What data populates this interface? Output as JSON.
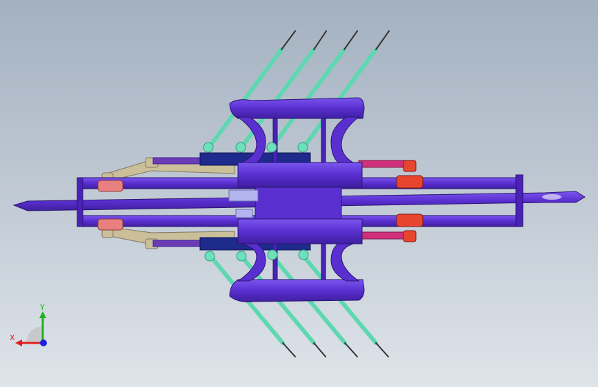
{
  "view": {
    "background_top": "#a3b1c0",
    "background_bottom": "#dfe4ea"
  },
  "model": {
    "colors": {
      "frame": "#5a2fd0",
      "frame_dark": "#3f1fa0",
      "frame_light": "#7a55ee",
      "rod": "#5dd8b0",
      "rod_dark": "#2f9a7a",
      "joint_red": "#e8452f",
      "joint_pink": "#e88080",
      "link_tan": "#cbbf9a",
      "bar_magenta": "#d0307a",
      "bar_violet": "#6a3bb3",
      "block_navy": "#1e2a8c",
      "pad_lilac": "#b3b3ee"
    }
  },
  "triad": {
    "x_label": "X",
    "y_label": "Y",
    "x_color": "#e02020",
    "y_color": "#20b020",
    "z_color": "#2020e0"
  }
}
